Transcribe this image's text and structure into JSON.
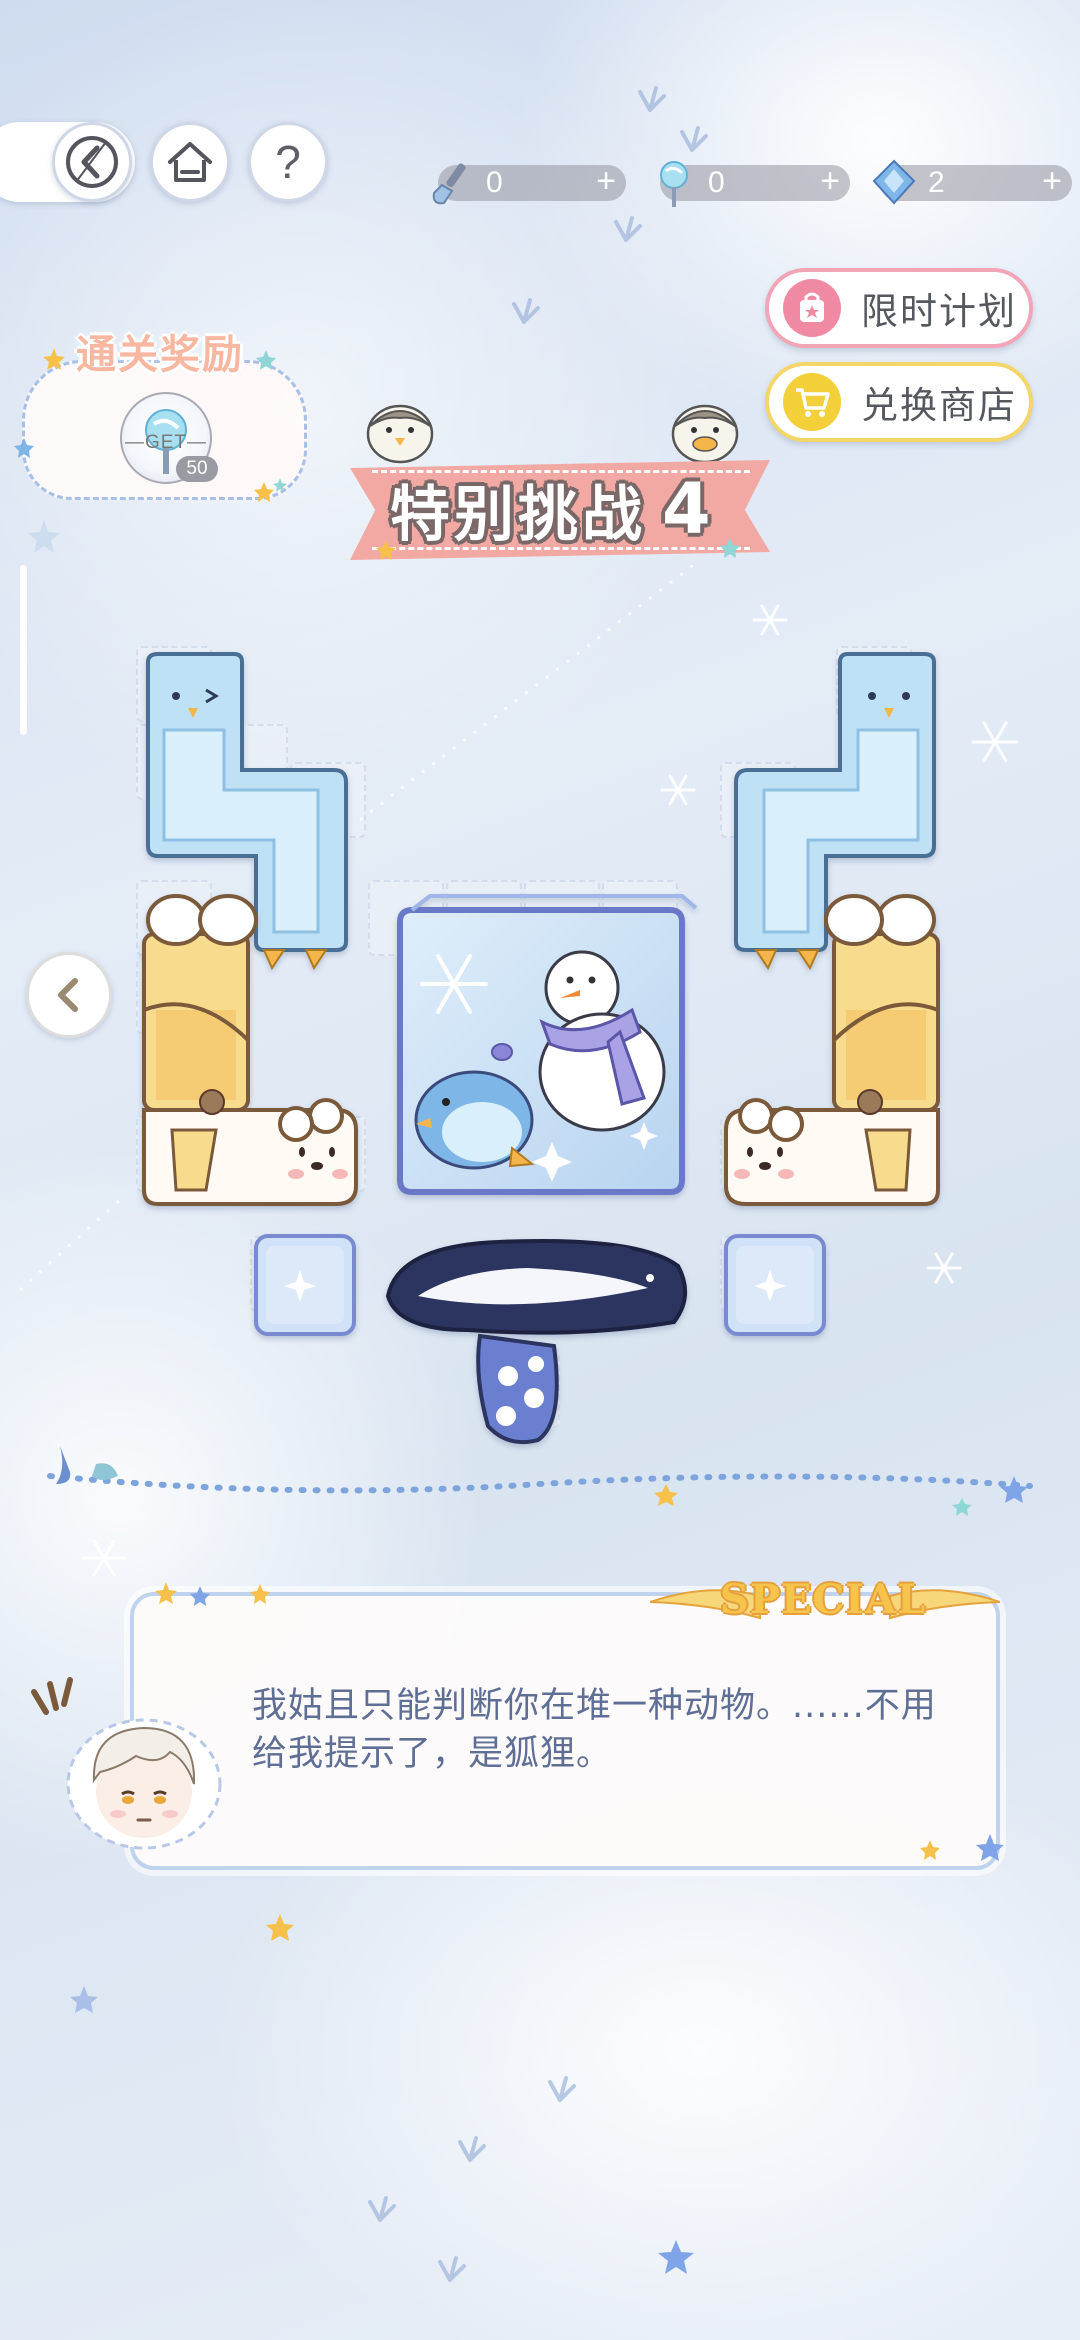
{
  "top_bar": {
    "help_symbol": "?",
    "resources": [
      {
        "name": "shovel",
        "value": "0",
        "plus": "+"
      },
      {
        "name": "lollipop",
        "value": "0",
        "plus": "+"
      },
      {
        "name": "gem",
        "value": "2",
        "plus": "+"
      }
    ]
  },
  "side_buttons": {
    "plan_label": "限时计划",
    "shop_label": "兑换商店"
  },
  "reward": {
    "title": "通关奖励",
    "get_label": "GET",
    "count": "50"
  },
  "level": {
    "title": "特别挑战",
    "number": "4"
  },
  "dialog": {
    "tag": "SPECIAL",
    "text": "我姑且只能判断你在堆一种动物。......不用给我提示了，是狐狸。"
  },
  "colors": {
    "banner": "#f2a9a3",
    "plan_accent": "#f08aa3",
    "shop_accent": "#f3cf3a",
    "dialog_text": "#5f6e95",
    "dialog_border": "#bfd2ee"
  }
}
